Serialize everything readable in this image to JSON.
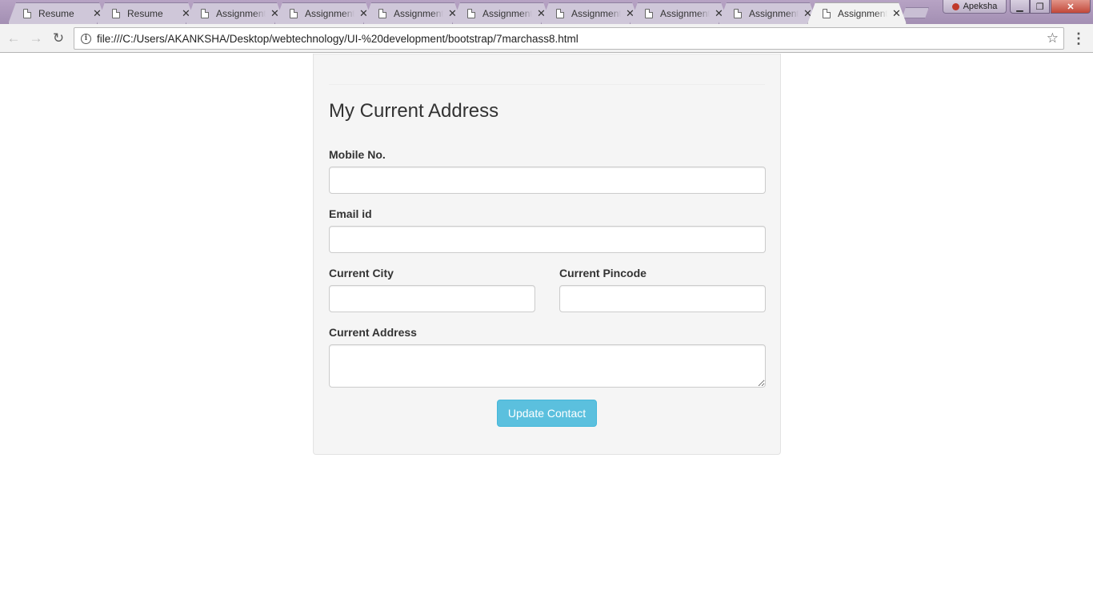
{
  "browser": {
    "tabs": [
      {
        "title": "Resume",
        "active": false
      },
      {
        "title": "Resume",
        "active": false
      },
      {
        "title": "Assignment",
        "active": false
      },
      {
        "title": "Assignment",
        "active": false
      },
      {
        "title": "Assignment",
        "active": false
      },
      {
        "title": "Assignment",
        "active": false
      },
      {
        "title": "Assignment",
        "active": false
      },
      {
        "title": "Assignment",
        "active": false
      },
      {
        "title": "Assignment",
        "active": false
      },
      {
        "title": "Assignment",
        "active": true
      }
    ],
    "tab_close_glyph": "✕",
    "profile_name": "Apeksha",
    "url": "file:///C:/Users/AKANKSHA/Desktop/webtechnology/UI-%20development/bootstrap/7marchass8.html",
    "back_glyph": "←",
    "forward_glyph": "→",
    "reload_glyph": "↻",
    "info_glyph": "i",
    "star_glyph": "☆",
    "menu_glyph": "⋮",
    "minimize_glyph": "▁",
    "maximize_glyph": "❐",
    "close_glyph": "✕"
  },
  "form": {
    "title": "My Current Address",
    "mobile_label": "Mobile No.",
    "mobile_value": "",
    "email_label": "Email id",
    "email_value": "",
    "city_label": "Current City",
    "city_value": "",
    "pincode_label": "Current Pincode",
    "pincode_value": "",
    "address_label": "Current Address",
    "address_value": "",
    "submit_label": "Update Contact"
  },
  "colors": {
    "well_background": "#f5f5f5",
    "button_info": "#5bc0de"
  }
}
